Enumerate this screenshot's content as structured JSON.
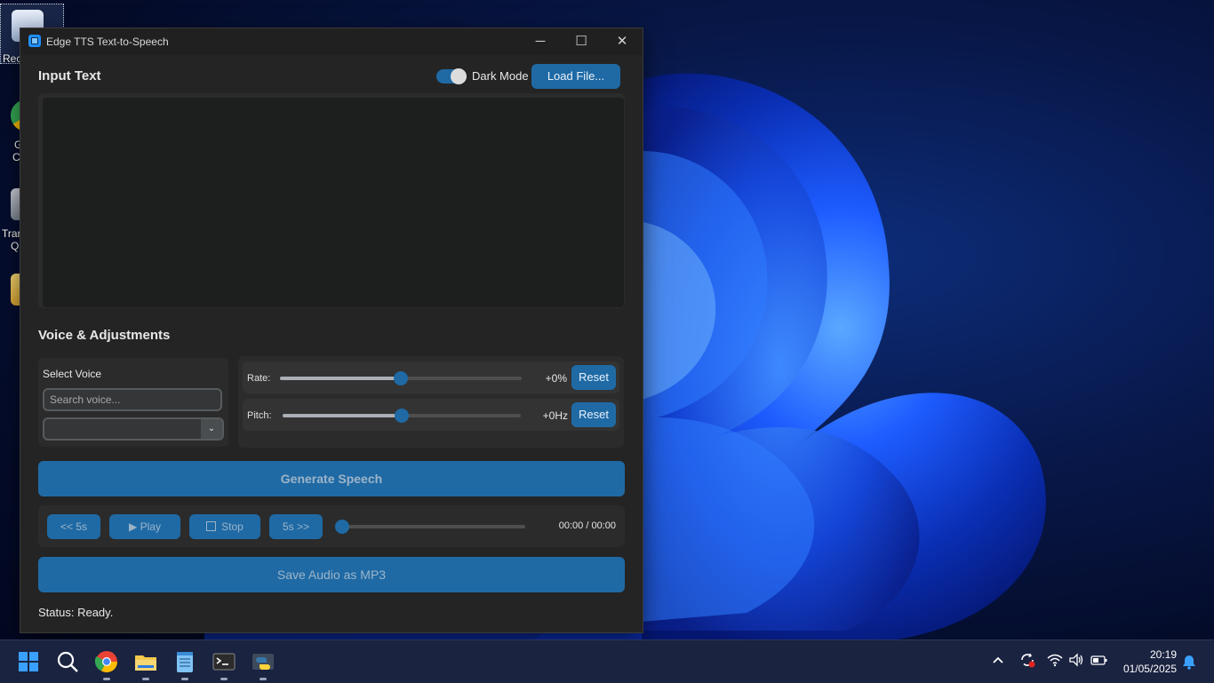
{
  "desktop": {
    "icons": [
      {
        "label": "Rec"
      },
      {
        "label": "G\nC"
      },
      {
        "label": "Trar\nQ"
      },
      {
        "label": ""
      }
    ]
  },
  "window": {
    "title": "Edge TTS Text-to-Speech",
    "controls": {
      "minimize": "─",
      "maximize": "☐",
      "close": "✕"
    }
  },
  "input_section": {
    "title": "Input Text",
    "dark_mode_label": "Dark Mode",
    "dark_mode_on": true,
    "load_file_label": "Load File...",
    "text_value": ""
  },
  "voice_section": {
    "title": "Voice & Adjustments",
    "select_voice_label": "Select Voice",
    "search_placeholder": "Search voice...",
    "selected_voice": "",
    "dropdown_arrow": "⌄"
  },
  "adjustments": {
    "rate": {
      "label": "Rate:",
      "value": "+0%",
      "level": 0.5,
      "reset_label": "Reset"
    },
    "pitch": {
      "label": "Pitch:",
      "value": "+0Hz",
      "level": 0.5,
      "reset_label": "Reset"
    }
  },
  "generate_label": "Generate Speech",
  "playback": {
    "back_label": "<< 5s",
    "play_label": "▶ Play",
    "stop_label": "Stop",
    "forward_label": "5s >>",
    "progress": 0,
    "time": "00:00 / 00:00"
  },
  "save_label": "Save Audio as MP3",
  "status": "Status: Ready.",
  "taskbar": {
    "apps": [
      "windows-start-icon",
      "search-icon",
      "chrome-icon",
      "file-explorer-icon",
      "notepad-icon",
      "terminal-icon",
      "python-icon"
    ],
    "tray": [
      "chevron-up-icon",
      "sync-icon",
      "wifi-icon",
      "volume-icon",
      "battery-icon",
      "notification-bell-icon"
    ],
    "clock_time": "20:19",
    "clock_date": "01/05/2025"
  },
  "colors": {
    "accent": "#1f6aa5",
    "window_bg": "#242424",
    "panel_bg": "#2b2b2b",
    "taskbar_bg": "#1a2340"
  }
}
